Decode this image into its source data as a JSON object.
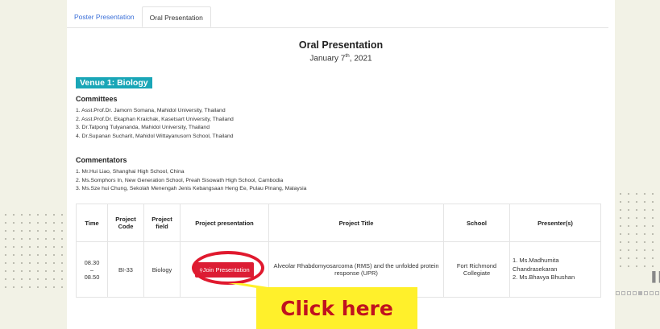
{
  "tabs": [
    {
      "label": "Poster Presentation",
      "active": false
    },
    {
      "label": "Oral Presentation",
      "active": true
    }
  ],
  "header": {
    "title": "Oral Presentation",
    "date_prefix": "January 7",
    "date_sup": "th",
    "date_suffix": ", 2021"
  },
  "venue": {
    "label": "Venue 1: Biology"
  },
  "committees": {
    "heading": "Committees",
    "items": [
      "1. Asst.Prof.Dr. Jamorn Somana, Mahidol University, Thailand",
      "2. Asst.Prof.Dr. Ekaphan Kraichak, Kasetsart University, Thailand",
      "3. Dr.Tatpong Tulyananda, Mahidol University, Thailand",
      "4. Dr.Supanan Sucharit, Mahidol Wittayanusorn School, Thailand"
    ]
  },
  "commentators": {
    "heading": "Commentators",
    "items": [
      "1. Mr.Hui Liao, Shanghai High School, China",
      "2. Ms.Somphors In, New Generation School, Preah Sisowath High School, Cambodia",
      "3. Ms.Sze hui Chung, Sekolah Menengah Jenis Kebangsaan Heng Ee, Pulau Pinang, Malaysia"
    ]
  },
  "table": {
    "headers": [
      "Time",
      "Project Code",
      "Project field",
      "Project presentation",
      "Project Title",
      "School",
      "Presenter(s)"
    ],
    "row": {
      "time_start": "08.30",
      "time_sep": "–",
      "time_end": "08.50",
      "code": "BI-33",
      "field": "Biology",
      "button": "Join Presentation",
      "title": "Alveolar Rhabdomyosarcoma (RMS) and the unfolded protein response (UPR)",
      "school": "Fort Richmond Collegiate",
      "presenters": [
        "1. Ms.Madhumita Chandrasekaran",
        "2. Ms.Bhavya Bhushan"
      ]
    }
  },
  "callout": {
    "text": "Click here"
  },
  "colors": {
    "accent": "#3a6fd8",
    "venue": "#1aa6b7",
    "button": "#dc1d34",
    "callout_bg": "#fff02b",
    "callout_text": "#c0121f"
  }
}
